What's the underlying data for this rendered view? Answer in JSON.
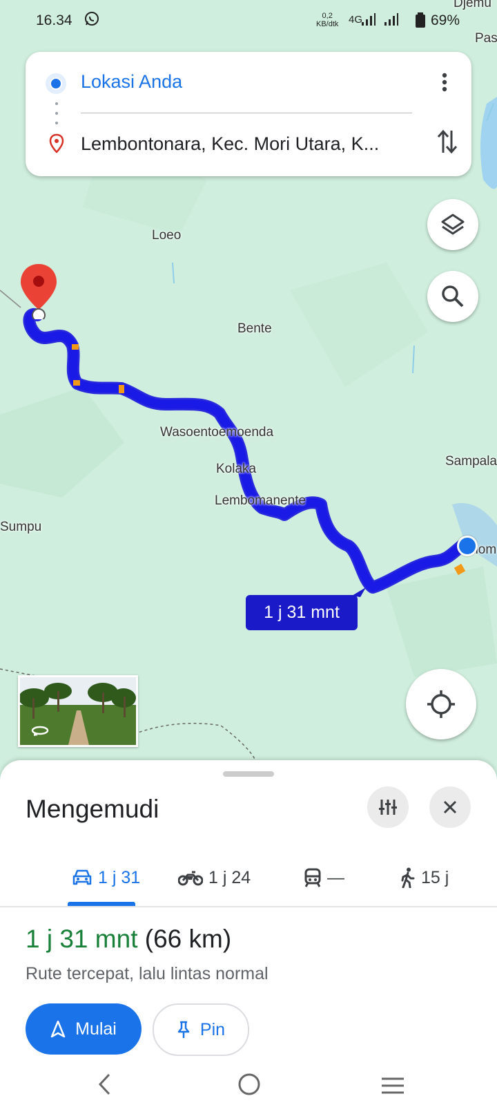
{
  "status_bar": {
    "time": "16.34",
    "network_speed_value": "0,2",
    "network_speed_unit": "KB/dtk",
    "network_type": "4G",
    "battery": "69%"
  },
  "map": {
    "places": [
      "Djemu",
      "Pas",
      "Loeo",
      "Bente",
      "Wasoentoemoenda",
      "Kolaka",
      "Lembomanente",
      "Sampala",
      "Sumpu",
      "Liom"
    ],
    "eta_label": "1 j 31 mnt"
  },
  "search": {
    "origin": "Lokasi Anda",
    "destination": "Lembontonara, Kec. Mori Utara, K..."
  },
  "sheet": {
    "title": "Mengemudi",
    "modes": [
      {
        "icon": "car-icon",
        "label": "1 j 31"
      },
      {
        "icon": "motorcycle-icon",
        "label": "1 j 24"
      },
      {
        "icon": "train-icon",
        "label": "—"
      },
      {
        "icon": "walk-icon",
        "label": "15 j"
      }
    ],
    "duration": "1 j 31 mnt",
    "distance": "(66 km)",
    "description": "Rute tercepat, lalu lintas normal",
    "start_label": "Mulai",
    "pin_label": "Pin"
  },
  "colors": {
    "route": "#1a1ae6",
    "accent": "#1a73e8",
    "duration_green": "#188038",
    "map_background": "#cfeedd"
  }
}
